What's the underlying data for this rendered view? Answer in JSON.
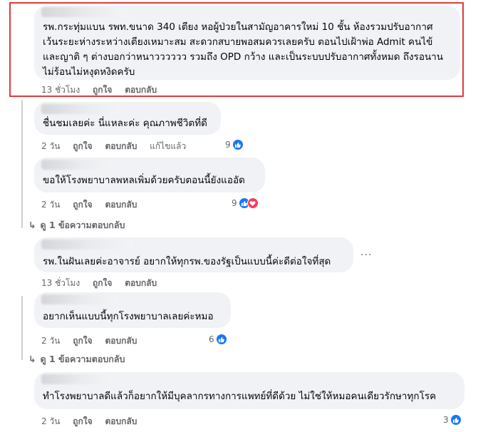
{
  "comments": [
    {
      "text_lines": [
        "รพ.กระทุ่มแบน รพท.ขนาด 340 เตียง หอผู้ป่วยในสามัญอาคารใหม่ 10 ชั้น ห้องรวมปรับอากาศ",
        "เว้นระยะห่างระหว่างเตียงเหมาะสม สะดวกสบายพอสมควรเลยครับ ตอนไปเฝ้าพ่อ Admit คนไข้",
        "และญาติ ๆ ต่างบอกว่าหนาวววววว รวมถึง OPD กว้าง และเป็นระบบปรับอากาศทั้งหมด ถึงรอนาน",
        "ไม่ร้อนไม่หงุดหงิดครับ"
      ],
      "time": "13 ชั่วโมง",
      "like": "ถูกใจ",
      "reply": "ตอบกลับ"
    },
    {
      "text_lines": [
        "ชื่นชมเลยค่ะ นี่แหละค่ะ คุณภาพชีวิตที่ดี"
      ],
      "time": "2 วัน",
      "like": "ถูกใจ",
      "reply": "ตอบกลับ",
      "edited": "แก้ไขแล้ว",
      "reaction_count": "9"
    },
    {
      "text_lines": [
        "ขอให้โรงพยาบาลพหลเพิ่มด้วยครับตอนนี้ยังแออัด"
      ],
      "time": "2 วัน",
      "like": "ถูกใจ",
      "reply": "ตอบกลับ",
      "reaction_count": "9",
      "view_replies": "ดู 1 ข้อความตอบกลับ"
    },
    {
      "text_lines": [
        "รพ.ในฝันเลยค่ะอาจารย์ อยากให้ทุกรพ.ของรัฐเป็นแบบนี้ค่ะดีต่อใจที่สุด"
      ],
      "time": "13 ชั่วโมง",
      "like": "ถูกใจ",
      "reply": "ตอบกลับ",
      "more": "···"
    },
    {
      "text_lines": [
        "อยากเห็นแบบนี้ทุกโรงพยาบาลเลยค่ะหมอ"
      ],
      "time": "2 วัน",
      "like": "ถูกใจ",
      "reply": "ตอบกลับ",
      "reaction_count": "6",
      "view_replies": "ดู 1 ข้อความตอบกลับ"
    },
    {
      "text_lines": [
        "ทำโรงพยาบาลดีแล้วก็อยากให้มีบุคลากรทางการแพทย์ที่ดีด้วย ไม่ใช่ให้หมอคนเดียวรักษาทุกโรค"
      ],
      "time": "2 วัน",
      "like": "ถูกใจ",
      "reply": "ตอบกลับ",
      "reaction_count": "3"
    }
  ],
  "colors": {
    "bubble": "#f0f2f5",
    "meta_text": "#65676b",
    "like_blue": "#1877f2",
    "love_red": "#f33e58",
    "highlight": "#e03b3b"
  }
}
